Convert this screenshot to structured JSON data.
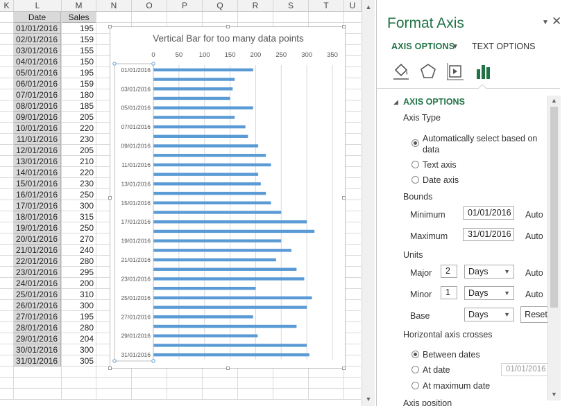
{
  "sheet": {
    "columns": [
      "K",
      "L",
      "M",
      "N",
      "O",
      "P",
      "Q",
      "R",
      "S",
      "T",
      "U"
    ],
    "header_date": "Date",
    "header_sales": "Sales",
    "rows": [
      {
        "date": "01/01/2016",
        "sales": "195"
      },
      {
        "date": "02/01/2016",
        "sales": "159"
      },
      {
        "date": "03/01/2016",
        "sales": "155"
      },
      {
        "date": "04/01/2016",
        "sales": "150"
      },
      {
        "date": "05/01/2016",
        "sales": "195"
      },
      {
        "date": "06/01/2016",
        "sales": "159"
      },
      {
        "date": "07/01/2016",
        "sales": "180"
      },
      {
        "date": "08/01/2016",
        "sales": "185"
      },
      {
        "date": "09/01/2016",
        "sales": "205"
      },
      {
        "date": "10/01/2016",
        "sales": "220"
      },
      {
        "date": "11/01/2016",
        "sales": "230"
      },
      {
        "date": "12/01/2016",
        "sales": "205"
      },
      {
        "date": "13/01/2016",
        "sales": "210"
      },
      {
        "date": "14/01/2016",
        "sales": "220"
      },
      {
        "date": "15/01/2016",
        "sales": "230"
      },
      {
        "date": "16/01/2016",
        "sales": "250"
      },
      {
        "date": "17/01/2016",
        "sales": "300"
      },
      {
        "date": "18/01/2016",
        "sales": "315"
      },
      {
        "date": "19/01/2016",
        "sales": "250"
      },
      {
        "date": "20/01/2016",
        "sales": "270"
      },
      {
        "date": "21/01/2016",
        "sales": "240"
      },
      {
        "date": "22/01/2016",
        "sales": "280"
      },
      {
        "date": "23/01/2016",
        "sales": "295"
      },
      {
        "date": "24/01/2016",
        "sales": "200"
      },
      {
        "date": "25/01/2016",
        "sales": "310"
      },
      {
        "date": "26/01/2016",
        "sales": "300"
      },
      {
        "date": "27/01/2016",
        "sales": "195"
      },
      {
        "date": "28/01/2016",
        "sales": "280"
      },
      {
        "date": "29/01/2016",
        "sales": "204"
      },
      {
        "date": "30/01/2016",
        "sales": "300"
      },
      {
        "date": "31/01/2016",
        "sales": "305"
      }
    ]
  },
  "chart_data": {
    "type": "bar",
    "orientation": "horizontal",
    "title": "Vertical Bar for too many data points",
    "categories": [
      "01/01/2016",
      "02/01/2016",
      "03/01/2016",
      "04/01/2016",
      "05/01/2016",
      "06/01/2016",
      "07/01/2016",
      "08/01/2016",
      "09/01/2016",
      "10/01/2016",
      "11/01/2016",
      "12/01/2016",
      "13/01/2016",
      "14/01/2016",
      "15/01/2016",
      "16/01/2016",
      "17/01/2016",
      "18/01/2016",
      "19/01/2016",
      "20/01/2016",
      "21/01/2016",
      "22/01/2016",
      "23/01/2016",
      "24/01/2016",
      "25/01/2016",
      "26/01/2016",
      "27/01/2016",
      "28/01/2016",
      "29/01/2016",
      "30/01/2016",
      "31/01/2016"
    ],
    "tick_labels": [
      "01/01/2016",
      "03/01/2016",
      "05/01/2016",
      "07/01/2016",
      "09/01/2016",
      "11/01/2016",
      "13/01/2016",
      "15/01/2016",
      "17/01/2016",
      "19/01/2016",
      "21/01/2016",
      "23/01/2016",
      "25/01/2016",
      "27/01/2016",
      "29/01/2016",
      "31/01/2016"
    ],
    "values": [
      195,
      159,
      155,
      150,
      195,
      159,
      180,
      185,
      205,
      220,
      230,
      205,
      210,
      220,
      230,
      250,
      300,
      315,
      250,
      270,
      240,
      280,
      295,
      200,
      310,
      300,
      195,
      280,
      204,
      300,
      305
    ],
    "x_ticks": [
      "0",
      "50",
      "100",
      "150",
      "200",
      "250",
      "300",
      "350"
    ],
    "xlim": [
      0,
      350
    ],
    "x_axis_position": "top",
    "grid": true,
    "bar_color": "#5b9bd5"
  },
  "pane": {
    "title": "Format Axis",
    "tab_axis": "AXIS OPTIONS",
    "tab_text": "TEXT OPTIONS",
    "section": "AXIS OPTIONS",
    "axis_type_label": "Axis Type",
    "radio_auto_line1": "Automatically select based on",
    "radio_auto_line2": "data",
    "radio_text": "Text axis",
    "radio_date": "Date axis",
    "bounds_label": "Bounds",
    "min_label": "Minimum",
    "min_value": "01/01/2016",
    "min_auto": "Auto",
    "max_label": "Maximum",
    "max_value": "31/01/2016",
    "max_auto": "Auto",
    "units_label": "Units",
    "major_label": "Major",
    "major_value": "2",
    "major_unit": "Days",
    "major_auto": "Auto",
    "minor_label": "Minor",
    "minor_value": "1",
    "minor_unit": "Days",
    "minor_auto": "Auto",
    "base_label": "Base",
    "base_unit": "Days",
    "reset_label": "Reset",
    "hcross_label": "Horizontal axis crosses",
    "radio_between": "Between dates",
    "radio_at_date": "At date",
    "at_date_value": "01/01/2016",
    "radio_max_date": "At maximum date",
    "axis_position_partial": "Axis position",
    "accent_color": "#217346"
  }
}
